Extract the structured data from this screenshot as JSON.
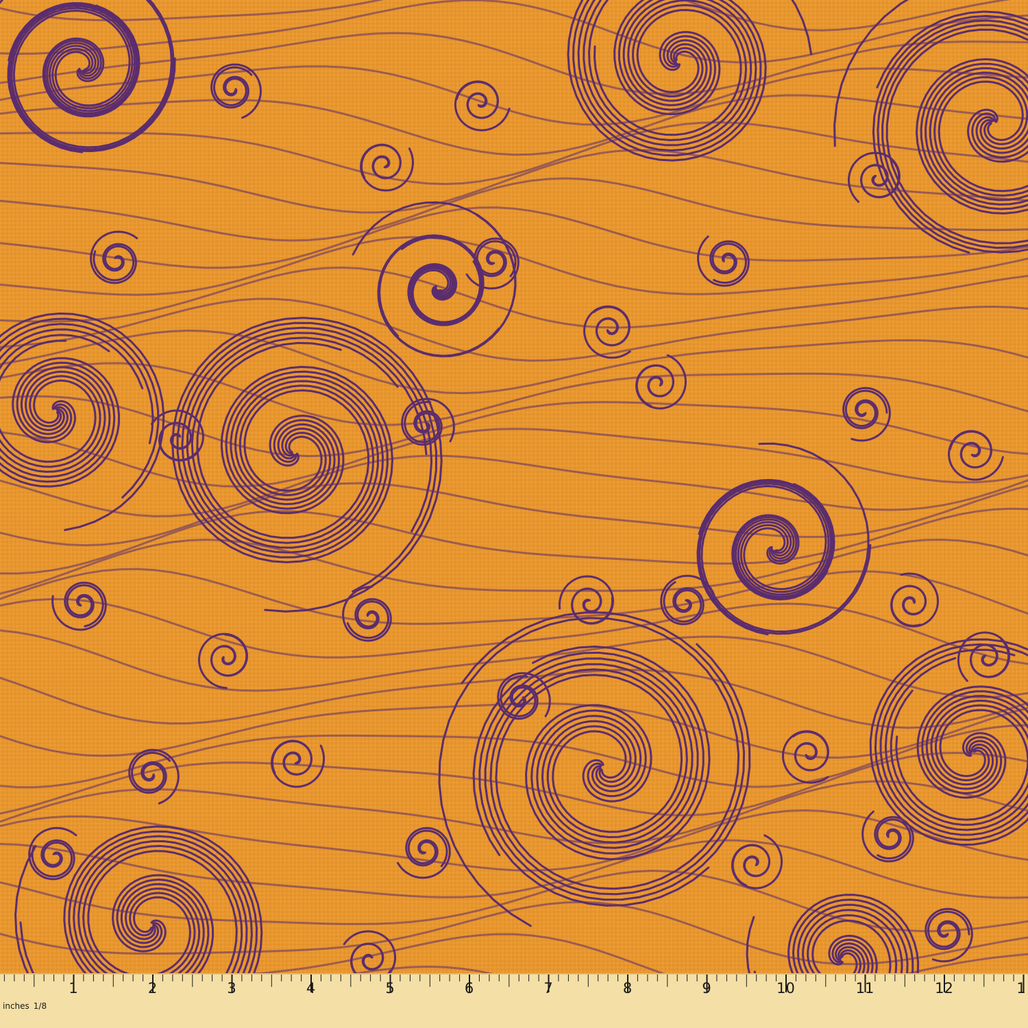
{
  "image": {
    "subject": "fabric-swatch",
    "pattern": "swirl-waves",
    "colors": {
      "background": "#e8962e",
      "line": "#5b2d6e",
      "ruler": "#f4dfa6",
      "ruler_text": "#1a1a1a"
    }
  },
  "ruler": {
    "unit_label": "inches",
    "fraction_label": "1/8",
    "numbers": [
      "1",
      "2",
      "3",
      "4",
      "5",
      "6",
      "7",
      "8",
      "9",
      "10",
      "11",
      "12",
      "1"
    ]
  }
}
